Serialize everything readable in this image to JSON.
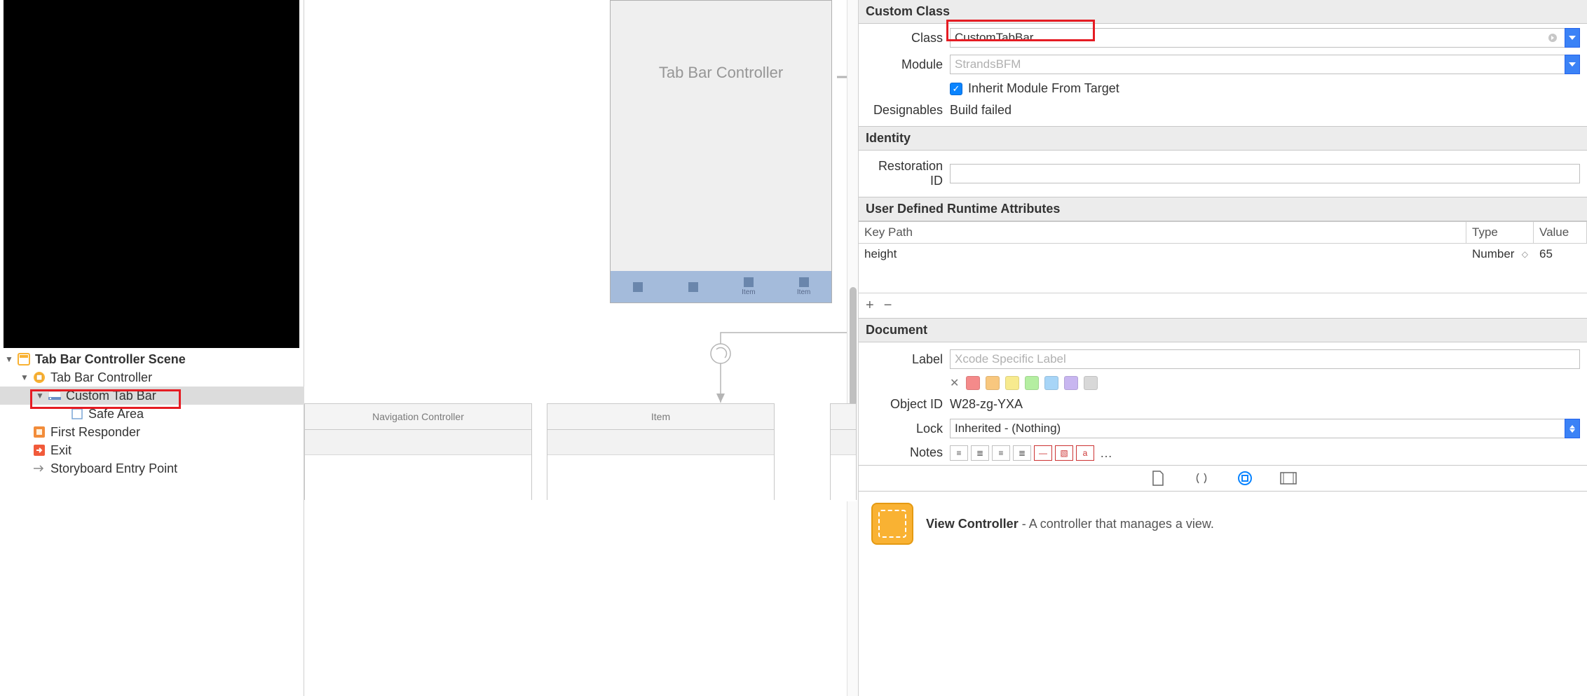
{
  "navigator": {
    "scene_title": "Tab Bar Controller Scene",
    "items": {
      "tabbar_controller": "Tab Bar Controller",
      "custom_tab_bar": "Custom Tab Bar",
      "safe_area": "Safe Area",
      "first_responder": "First Responder",
      "exit": "Exit",
      "entry_point": "Storyboard Entry Point"
    }
  },
  "canvas": {
    "vc_title": "Tab Bar Controller",
    "tab_items": [
      "",
      "",
      "Item",
      "Item"
    ],
    "child_scenes": [
      "Navigation Controller",
      "Item"
    ]
  },
  "inspector": {
    "sections": {
      "custom_class": "Custom Class",
      "identity": "Identity",
      "udra": "User Defined Runtime Attributes",
      "document": "Document"
    },
    "labels": {
      "class": "Class",
      "module": "Module",
      "inherit": "Inherit Module From Target",
      "designables": "Designables",
      "restoration": "Restoration ID",
      "label": "Label",
      "object_id": "Object ID",
      "lock": "Lock",
      "notes": "Notes"
    },
    "values": {
      "class": "CustomTabBar",
      "module_placeholder": "StrandsBFM",
      "designables": "Build failed",
      "object_id": "W28-zg-YXA",
      "lock": "Inherited - (Nothing)",
      "label_placeholder": "Xcode Specific Label"
    },
    "udra_headers": {
      "key": "Key Path",
      "type": "Type",
      "value": "Value"
    },
    "udra_row": {
      "key": "height",
      "type": "Number",
      "value": "65"
    },
    "swatches": [
      "#f48a8a",
      "#f8c77e",
      "#f7ea8e",
      "#b4eea1",
      "#a7d5f7",
      "#c8b6f0",
      "#d8d8d8"
    ]
  },
  "library": {
    "item_title": "View Controller",
    "item_desc": " - A controller that manages a view."
  }
}
